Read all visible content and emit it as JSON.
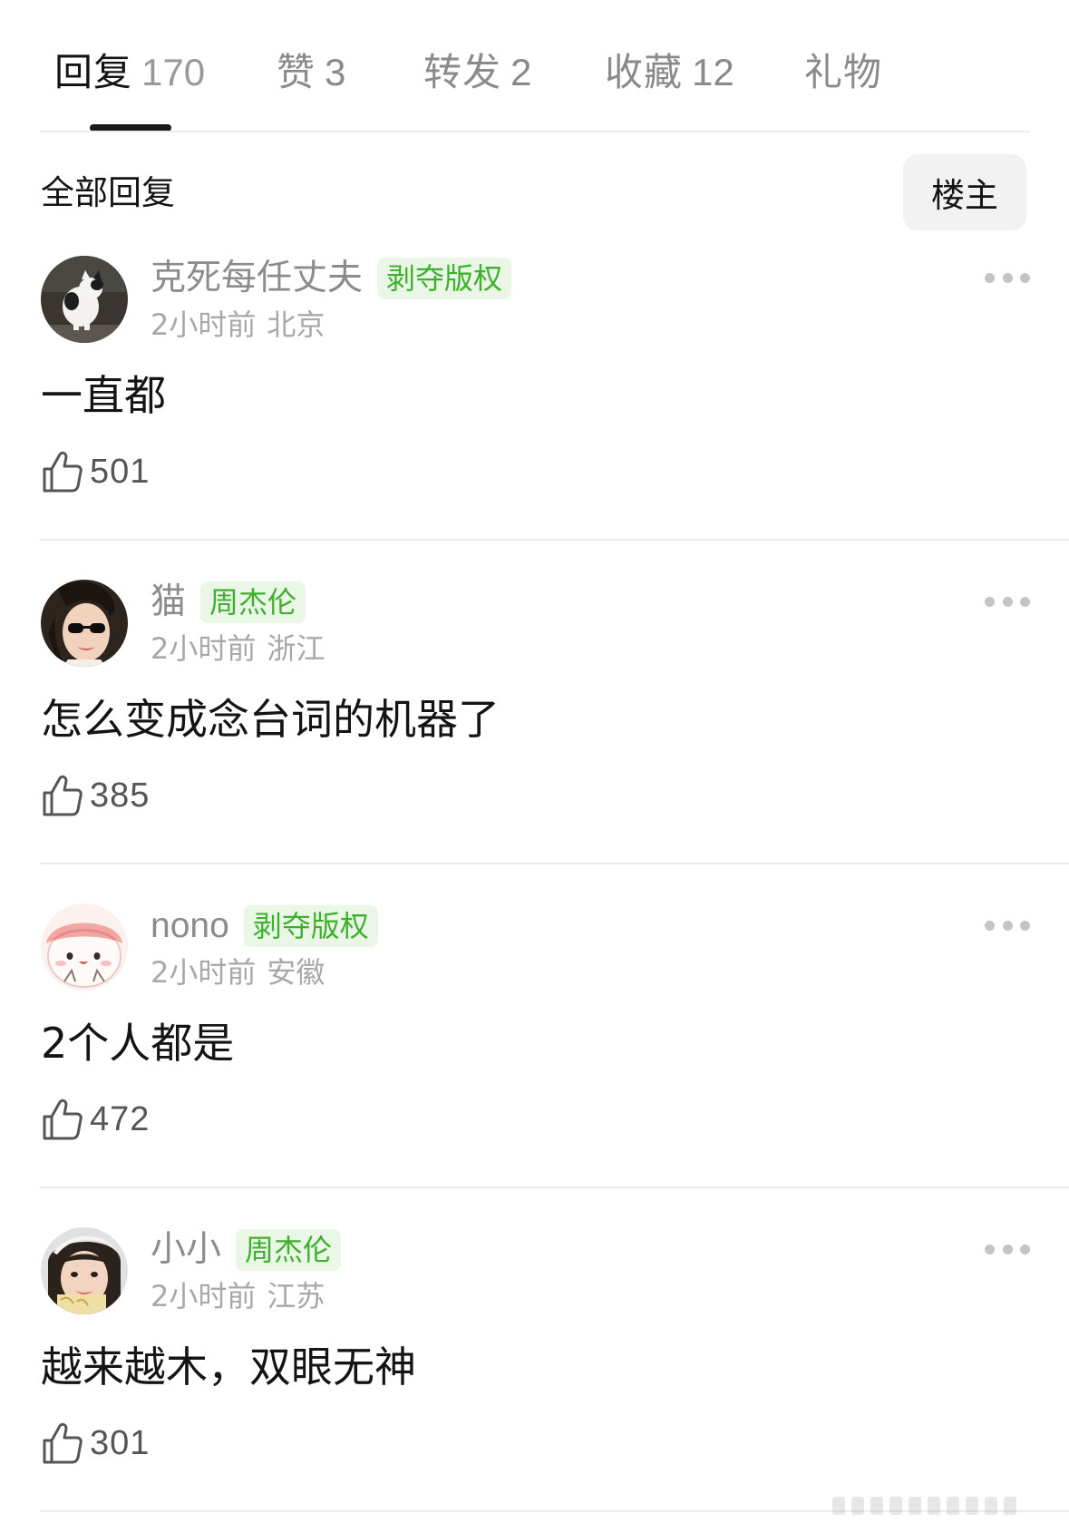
{
  "tabs": [
    {
      "label": "回复",
      "count": "170",
      "active": true
    },
    {
      "label": "赞",
      "count": "3",
      "active": false
    },
    {
      "label": "转发",
      "count": "2",
      "active": false
    },
    {
      "label": "收藏",
      "count": "12",
      "active": false
    },
    {
      "label": "礼物",
      "count": "",
      "active": false
    }
  ],
  "section": {
    "title": "全部回复",
    "owner_filter": "楼主"
  },
  "comments": [
    {
      "username": "克死每任丈夫",
      "badge": "剥夺版权",
      "time": "2小时前",
      "location": "北京",
      "text": "一直都",
      "likes": "501",
      "avatar": "cat-photo"
    },
    {
      "username": "猫",
      "badge": "周杰伦",
      "time": "2小时前",
      "location": "浙江",
      "text": "怎么变成念台词的机器了",
      "likes": "385",
      "avatar": "woman-sunglasses-photo"
    },
    {
      "username": "nono",
      "badge": "剥夺版权",
      "time": "2小时前",
      "location": "安徽",
      "text": "2个人都是",
      "likes": "472",
      "avatar": "cartoon-face"
    },
    {
      "username": "小小",
      "badge": "周杰伦",
      "time": "2小时前",
      "location": "江苏",
      "text": "越来越木，双眼无神",
      "likes": "301",
      "avatar": "girl-photo"
    }
  ],
  "colors": {
    "badge_text": "#3fb02d",
    "badge_bg": "#eaf7e6",
    "muted": "#8c8c8c",
    "indicator": "#1a1a1a"
  }
}
